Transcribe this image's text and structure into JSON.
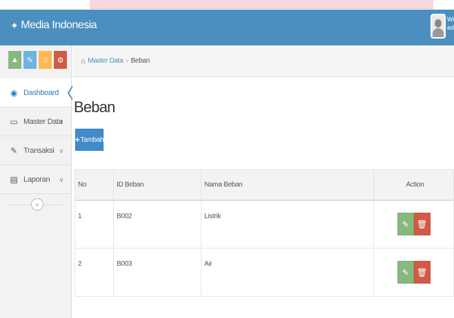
{
  "header": {
    "brand": "Media Indonesia",
    "welcome_line1": "We",
    "welcome_line2": "ad"
  },
  "sidebar": {
    "shortcuts": [
      {
        "icon": "chart-icon",
        "color": "#87b87f"
      },
      {
        "icon": "pencil-icon",
        "color": "#6fb3e0"
      },
      {
        "icon": "users-icon",
        "color": "#ffb752"
      },
      {
        "icon": "cogs-icon",
        "color": "#d15b47"
      }
    ],
    "items": [
      {
        "label": "Dashboard",
        "icon": "dashboard-icon",
        "active": true
      },
      {
        "label": "Master Data",
        "icon": "desktop-icon",
        "chevron": "v"
      },
      {
        "label": "Transaksi",
        "icon": "edit-icon",
        "chevron": "v"
      },
      {
        "label": "Laporan",
        "icon": "list-icon",
        "chevron": "v"
      }
    ],
    "collapse_icon": "«"
  },
  "breadcrumb": {
    "parent": "Master Data",
    "separator": "›",
    "current": "Beban"
  },
  "page": {
    "title": "Beban",
    "add_button_icon": "+",
    "add_button_label": "Tambah"
  },
  "table": {
    "columns": [
      "No",
      "ID Beban",
      "Nama Beban",
      "Action"
    ],
    "rows": [
      {
        "no": "1",
        "id": "B002",
        "name": "Listrik"
      },
      {
        "no": "2",
        "id": "B003",
        "name": "Air"
      }
    ]
  },
  "colors": {
    "navbar": "#4a8fc0",
    "primary": "#428bca",
    "success": "#87b87f",
    "danger": "#d15b47"
  }
}
